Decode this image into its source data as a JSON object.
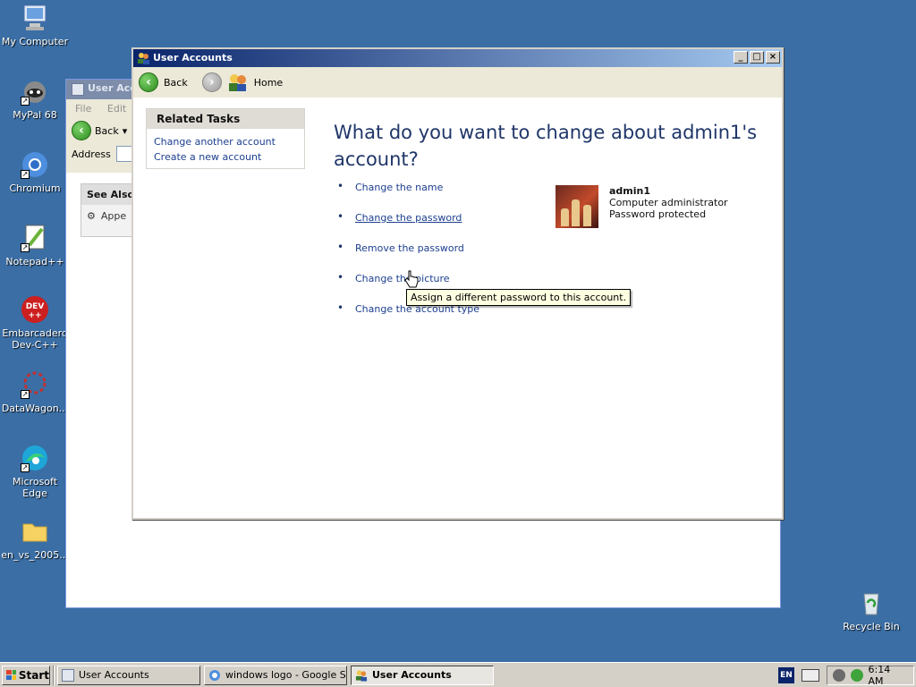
{
  "desktop": {
    "icons": [
      {
        "label": "My Computer",
        "icon": "my-computer-icon"
      },
      {
        "label": "MyPal 68",
        "icon": "mypal-icon"
      },
      {
        "label": "Chromium",
        "icon": "chromium-icon"
      },
      {
        "label": "Notepad++",
        "icon": "notepad-plus-plus-icon"
      },
      {
        "label": "Embarcadero Dev-C++",
        "icon": "devcpp-icon"
      },
      {
        "label": "DataWagon...",
        "icon": "datawagon-icon"
      },
      {
        "label": "Microsoft Edge",
        "icon": "edge-icon"
      },
      {
        "label": "en_vs_2005...",
        "icon": "folder-icon"
      },
      {
        "label": "Recycle Bin",
        "icon": "recycle-bin-icon"
      }
    ]
  },
  "bg_window": {
    "title": "User Acco",
    "menu": [
      "File",
      "Edit"
    ],
    "back_label": "Back",
    "address_label": "Address",
    "see_also_title": "See Also",
    "see_also_item": "Appe"
  },
  "window": {
    "title": "User Accounts",
    "nav": {
      "back": "Back",
      "home": "Home"
    },
    "related_tasks": {
      "title": "Related Tasks",
      "links": [
        "Change another account",
        "Create a new account"
      ]
    },
    "question": "What do you want to change about admin1's account?",
    "options": [
      "Change the name",
      "Change the password",
      "Remove the password",
      "Change the picture",
      "Change the account type"
    ],
    "account": {
      "name": "admin1",
      "type": "Computer administrator",
      "status": "Password protected"
    },
    "tooltip": "Assign a different password to this account."
  },
  "taskbar": {
    "start": "Start",
    "tasks": [
      {
        "label": "User Accounts",
        "active": false
      },
      {
        "label": "windows logo - Google S...",
        "active": false
      },
      {
        "label": "User Accounts",
        "active": true
      }
    ],
    "lang": "EN",
    "time": "6:14 AM"
  }
}
